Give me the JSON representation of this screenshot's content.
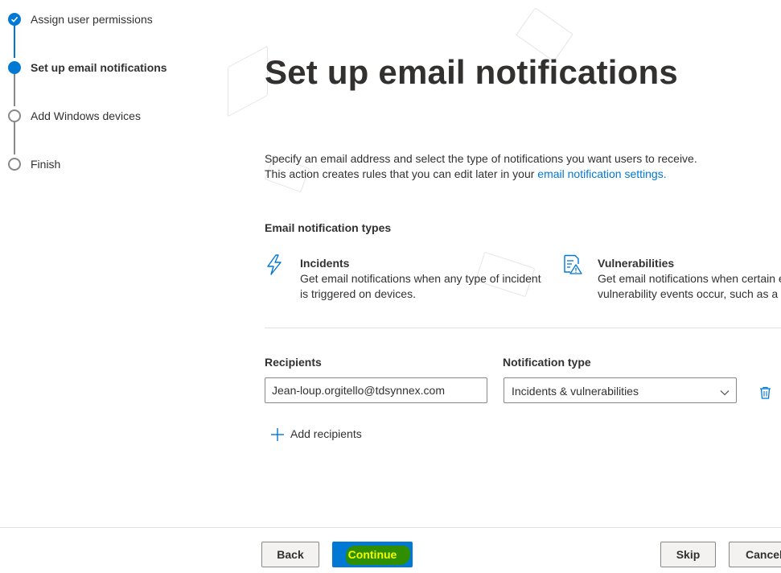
{
  "stepper": {
    "steps": [
      {
        "label": "Assign user permissions",
        "state": "complete"
      },
      {
        "label": "Set up email notifications",
        "state": "current"
      },
      {
        "label": "Add Windows devices",
        "state": "pending"
      },
      {
        "label": "Finish",
        "state": "pending"
      }
    ]
  },
  "main": {
    "title": "Set up email notifications",
    "description_line1": "Specify an email address and select the type of notifications you want users to receive.",
    "description_line2_prefix": "This action creates rules that you can edit later in your ",
    "description_link": "email notification settings.",
    "section_heading": "Email notification types",
    "types": [
      {
        "icon": "lightning-icon",
        "name": "Incidents",
        "line1": "Get email notifications when any type of incident",
        "line2": "is triggered on devices."
      },
      {
        "icon": "vulnerability-report-icon",
        "name": "Vulnerabilities",
        "line1": "Get email notifications when certain e",
        "line2": "vulnerability events occur, such as a n"
      }
    ],
    "recipients_label": "Recipients",
    "recipient_value": "Jean-loup.orgitello@tdsynnex.com",
    "notification_type_label": "Notification type",
    "notification_type_value": "Incidents & vulnerabilities",
    "add_recipients_label": "Add recipients"
  },
  "footer": {
    "back_label": "Back",
    "continue_label": "Continue",
    "skip_label": "Skip",
    "cancel_label": "Cancel"
  },
  "colors": {
    "accent": "#0078d4",
    "text": "#323130",
    "border": "#8a8886",
    "highlight_marker": "#2f8f00",
    "highlight_text": "#f4ff00"
  }
}
